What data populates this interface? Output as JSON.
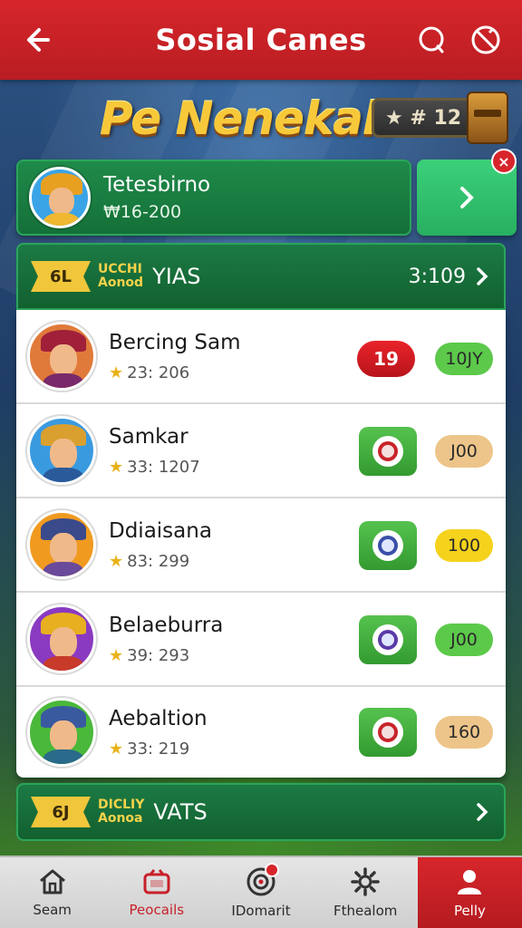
{
  "header": {
    "title": "Sosial Canes"
  },
  "banner": {
    "logo": "Pe Nenekak",
    "level": "★ # 12"
  },
  "profile": {
    "name": "Tetesbirno",
    "score": "₩16-200"
  },
  "section_top": {
    "badge": "6L",
    "small_line1": "UCCHI",
    "small_line2": "Aonod",
    "title": "YIAS",
    "right": "3:109"
  },
  "players": [
    {
      "name": "Bercing Sam",
      "score": "23: 206",
      "action_label": "19",
      "action_type": "red",
      "pill": "10JY",
      "pill_color": "#5cc94a"
    },
    {
      "name": "Samkar",
      "score": "33: 1207",
      "action_label": "",
      "action_type": "green",
      "pill": "J00",
      "pill_color": "#edc58a"
    },
    {
      "name": "Ddiaisana",
      "score": "83: 299",
      "action_label": "",
      "action_type": "green",
      "pill": "100",
      "pill_color": "#f5d21c"
    },
    {
      "name": "Belaeburra",
      "score": "39: 293",
      "action_label": "",
      "action_type": "green",
      "pill": "J00",
      "pill_color": "#5cc94a"
    },
    {
      "name": "Aebaltion",
      "score": "33: 219",
      "action_label": "",
      "action_type": "green",
      "pill": "160",
      "pill_color": "#edc58a"
    }
  ],
  "section_bottom": {
    "badge": "6J",
    "small_line1": "DICLIY",
    "small_line2": "Aonoa",
    "title": "VATS"
  },
  "nav": [
    {
      "label": "Seam",
      "icon": "home-icon"
    },
    {
      "label": "Peocails",
      "icon": "store-icon"
    },
    {
      "label": "IDomarit",
      "icon": "target-icon"
    },
    {
      "label": "Fthealom",
      "icon": "gear-icon"
    },
    {
      "label": "Pelly",
      "icon": "person-icon"
    }
  ],
  "colors": {
    "header_red": "#d7262b",
    "panel_green": "#1c7a44",
    "accent_gold": "#f7c93a"
  }
}
